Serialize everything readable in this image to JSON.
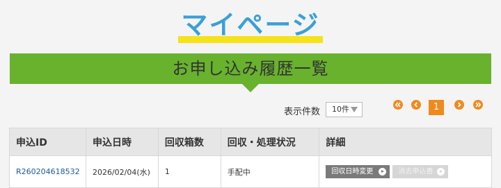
{
  "header": {
    "title": "マイページ"
  },
  "banner": {
    "title": "お申し込み履歴一覧"
  },
  "controls": {
    "display_count_label": "表示件数",
    "display_count_value": "10件",
    "current_page": "1"
  },
  "table": {
    "headers": [
      "申込ID",
      "申込日時",
      "回収箱数",
      "回収・処理状況",
      "詳細"
    ],
    "rows": [
      {
        "id": "R260204618532",
        "date": "2026/02/04(水)",
        "boxes": "1",
        "status": "手配中",
        "change_button": "回収日時変更",
        "cancel_button": "消去申込書"
      }
    ]
  },
  "colors": {
    "title_blue": "#3aa0d8",
    "title_underline": "#f5e21a",
    "banner_green": "#68b22e",
    "pager_orange": "#f08a1c",
    "id_link": "#1a5aa0"
  },
  "icons": {
    "pager_first": "double-chevron-left-icon",
    "pager_prev": "chevron-left-icon",
    "pager_next": "chevron-right-icon",
    "pager_last": "double-chevron-right-icon"
  }
}
